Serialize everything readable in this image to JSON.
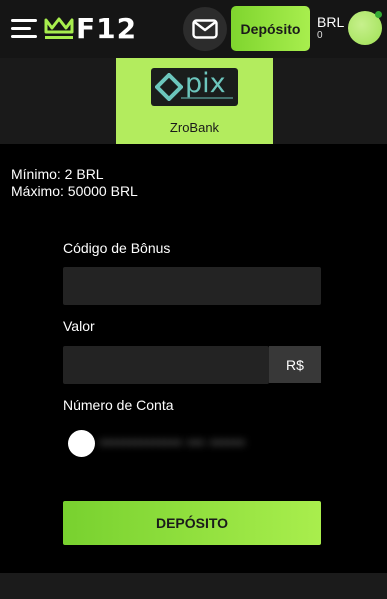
{
  "header": {
    "logo_text": "F12",
    "deposit_label": "Depósito",
    "currency": "BRL",
    "balance": "0"
  },
  "payment_method": {
    "logo_text": "pix",
    "name": "ZroBank"
  },
  "limits": {
    "min": "Mínimo: 2 BRL",
    "max": "Máximo: 50000 BRL"
  },
  "form": {
    "bonus_label": "Código de Bônus",
    "bonus_value": "",
    "amount_label": "Valor",
    "amount_value": "",
    "amount_suffix": "R$",
    "account_label": "Número de Conta",
    "account_value": "•••••••••••••• ••• ••••••",
    "submit_label": "DEPÓSITO"
  },
  "colors": {
    "accent": "#a8ee4e",
    "background": "#000000"
  }
}
